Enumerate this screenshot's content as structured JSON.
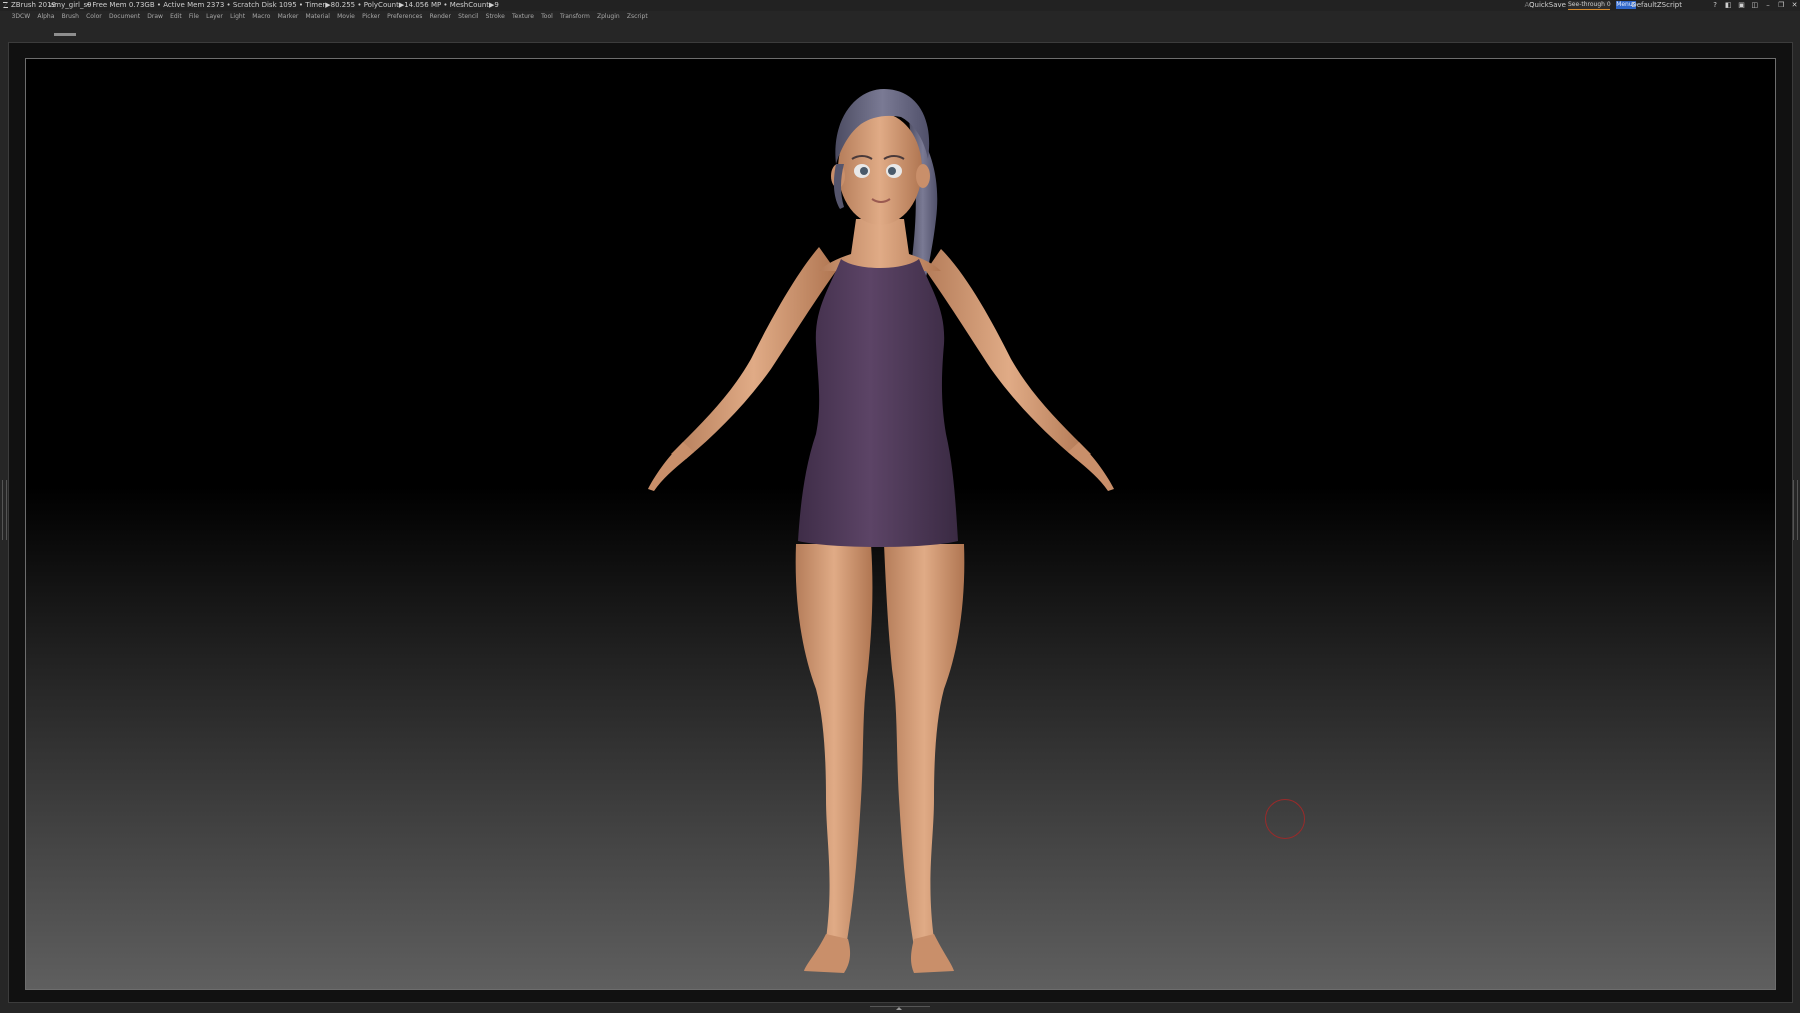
{
  "titlebar": {
    "app_name": "ZBrush 2019",
    "document_name": "amy_girl_s9",
    "stats": "• Free Mem 0.73GB • Active Mem 2373 • Scratch Disk 1095 • Timer▶80.255 • PolyCount▶14.056 MP • MeshCount▶9",
    "ac_label": "AC",
    "quicksave_label": "QuickSave",
    "seethrough_label": "See-through   0",
    "menus_label": "Menus",
    "defaultzscript_label": "DefaultZScript"
  },
  "menubar": {
    "items": [
      "3DCW",
      "Alpha",
      "Brush",
      "Color",
      "Document",
      "Draw",
      "Edit",
      "File",
      "Layer",
      "Light",
      "Macro",
      "Marker",
      "Material",
      "Movie",
      "Picker",
      "Preferences",
      "Render",
      "Stencil",
      "Stroke",
      "Texture",
      "Tool",
      "Transform",
      "Zplugin",
      "Zscript"
    ]
  },
  "colors": {
    "skin": "#d49d79",
    "dress": "#57405f",
    "hair": "#6a6a82",
    "accent_blue": "#2f66c8",
    "accent_orange": "#d88a2a",
    "brush_cursor": "#9a2a2a"
  }
}
